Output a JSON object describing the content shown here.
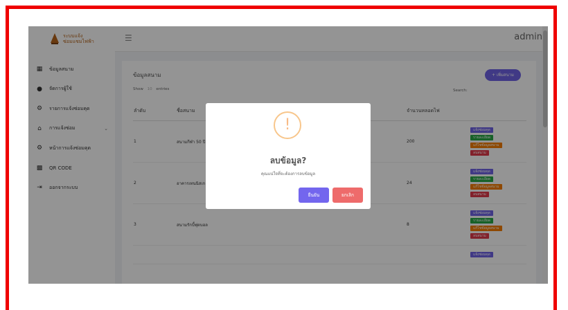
{
  "brand": {
    "line1": "ระบบแจ้ง",
    "line2": "ซ่อมแซมไฟฟ้า"
  },
  "sidebar": {
    "items": [
      {
        "label": "ข้อมูลสนาม",
        "icon": "grid-icon"
      },
      {
        "label": "จัดการผู้ใช้",
        "icon": "user-icon"
      },
      {
        "label": "รายการแจ้งซ่อมคุด",
        "icon": "gear-icon"
      },
      {
        "label": "การแจ้งซ่อม",
        "icon": "stadium-icon"
      },
      {
        "label": "หน้าการแจ้งซ่อมคุด",
        "icon": "gear-icon"
      },
      {
        "label": "QR CODE",
        "icon": "qr-icon"
      },
      {
        "label": "ออกจากระบบ",
        "icon": "logout-icon"
      }
    ]
  },
  "header": {
    "user": "admin"
  },
  "card": {
    "title": "ข้อมูลสนาม",
    "add_button": "+ เพิ่มสนาม",
    "show_label": "Show",
    "show_value": "10",
    "entries_label": "entries",
    "search_label": "Search:",
    "columns": [
      "ลำดับ",
      "ชื่อสนาม",
      "จำนวนหลอดไฟ"
    ],
    "rows": [
      {
        "no": "1",
        "name": "สนามกีฬา 50 ปี",
        "lamps": "200"
      },
      {
        "no": "2",
        "name": "อาคารเทนนิสเก",
        "lamps": "24"
      },
      {
        "no": "3",
        "name": "สนามรักบี้ฟุตบอล",
        "lamps": "8"
      }
    ],
    "actions": [
      "แจ้งซ่อมคุด",
      "รายละเอียด",
      "แก้ไขข้อมูลสนาม",
      "ลบสนาม"
    ]
  },
  "modal": {
    "icon": "!",
    "title": "ลบข้อมูล?",
    "text": "คุณแน่ใจที่จะต้องการลบข้อมูล",
    "confirm": "ยืนยัน",
    "cancel": "ยกเลิก"
  }
}
